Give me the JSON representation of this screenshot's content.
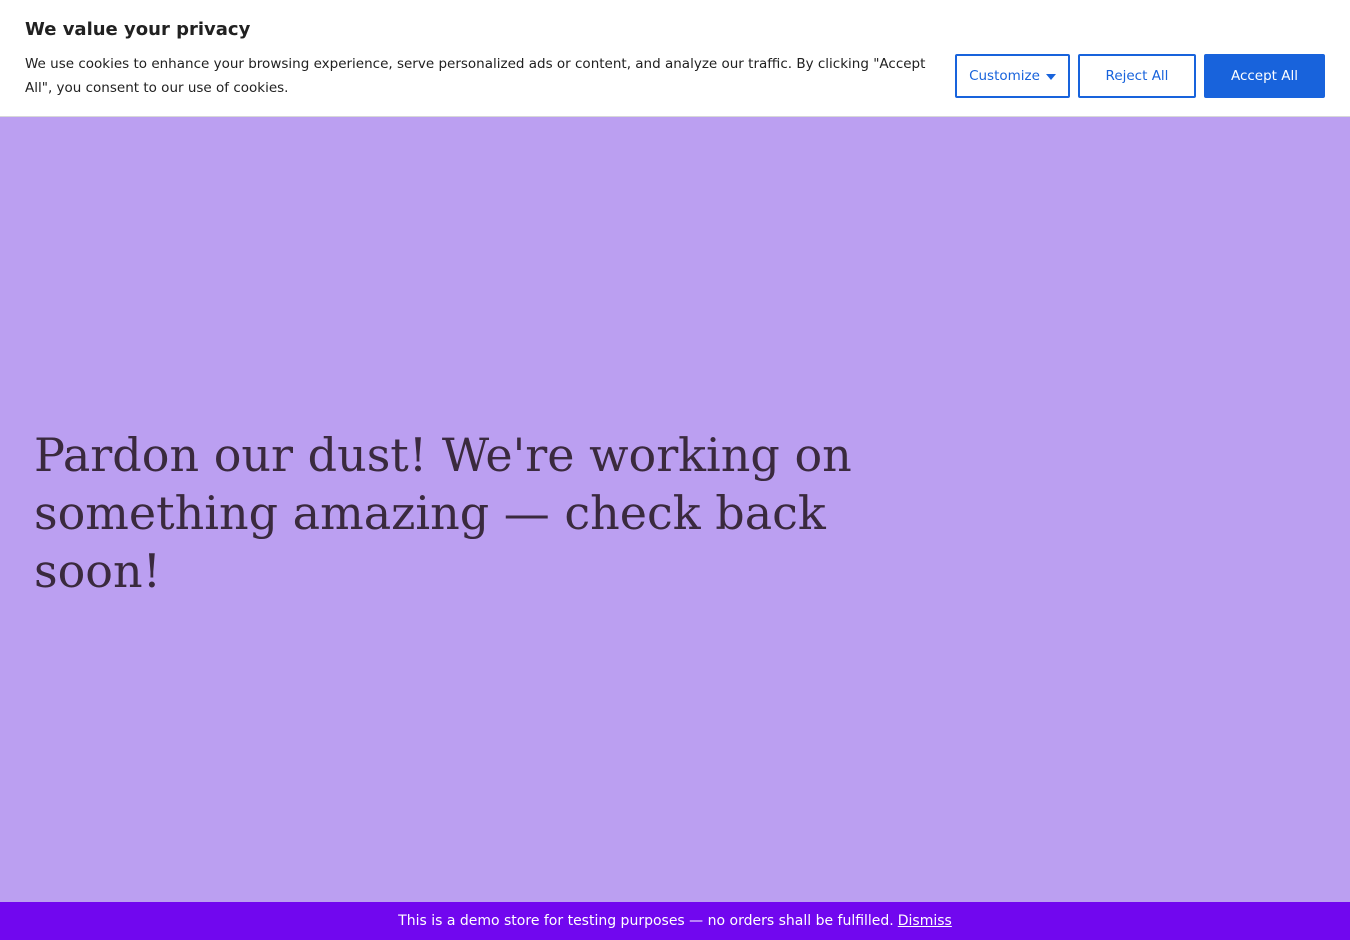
{
  "cookie_banner": {
    "title": "We value your privacy",
    "text": "We use cookies to enhance your browsing experience, serve personalized ads or content, and analyze our traffic. By clicking \"Accept All\", you consent to our use of cookies.",
    "customize_label": "Customize",
    "reject_label": "Reject All",
    "accept_label": "Accept All"
  },
  "hero": {
    "heading": "Pardon our dust! We're working on something amazing — check back soon!"
  },
  "store_notice": {
    "text": "This is a demo store for testing purposes — no orders shall be fulfilled.",
    "dismiss_label": "Dismiss"
  },
  "colors": {
    "accent": "#1863dc",
    "hero_background": "#bb9ff1",
    "notice_background": "#7107ef",
    "heading_text": "#3a2a3e"
  },
  "icons": {
    "customize_dropdown": "caret-down-icon"
  }
}
